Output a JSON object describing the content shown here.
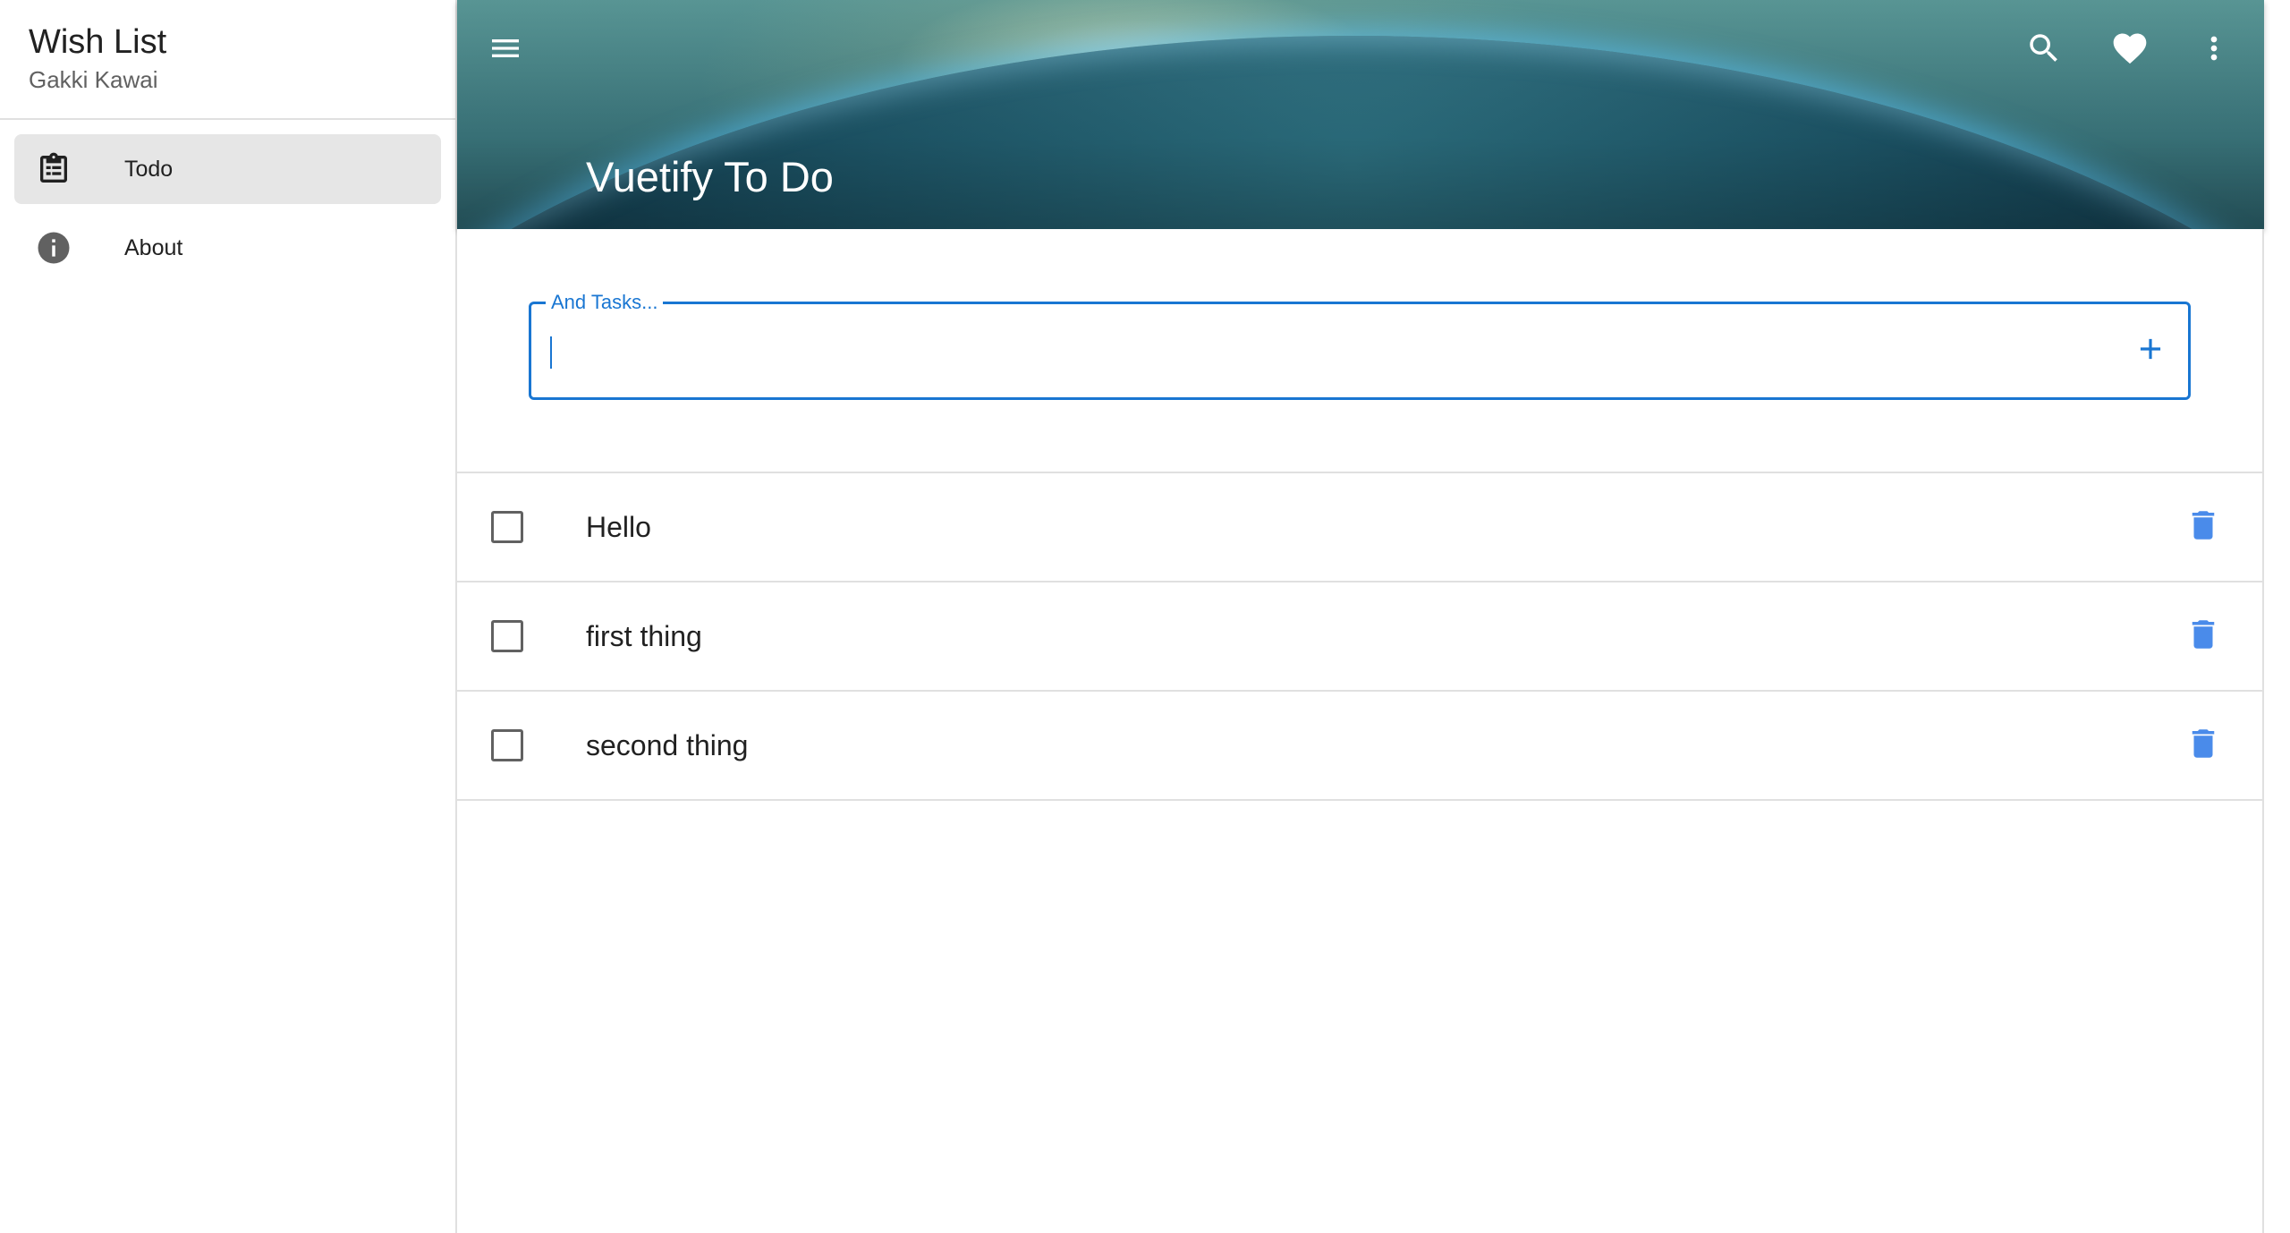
{
  "sidebar": {
    "title": "Wish List",
    "subtitle": "Gakki Kawai",
    "items": [
      {
        "label": "Todo",
        "icon": "clipboard-list-icon",
        "active": true
      },
      {
        "label": "About",
        "icon": "info-icon",
        "active": false
      }
    ]
  },
  "toolbar": {
    "title": "Vuetify To Do",
    "icons": [
      "menu-icon",
      "search-icon",
      "heart-icon",
      "more-vert-icon"
    ]
  },
  "task_input": {
    "label": "And Tasks...",
    "value": ""
  },
  "tasks": [
    {
      "title": "Hello",
      "done": false
    },
    {
      "title": "first thing",
      "done": false
    },
    {
      "title": "second thing",
      "done": false
    }
  ],
  "colors": {
    "accent": "#1976d2",
    "delete_icon": "#4a8bea",
    "active_nav_bg": "#e6e6e6"
  }
}
